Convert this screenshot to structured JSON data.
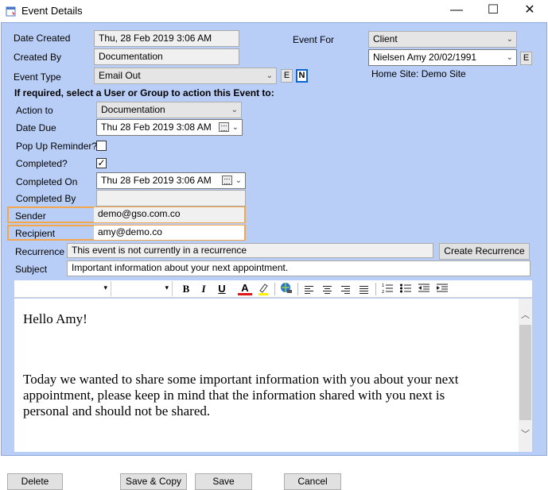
{
  "window": {
    "title": "Event Details",
    "minimize": "—",
    "maximize": "☐",
    "close": "✕"
  },
  "labels": {
    "date_created": "Date Created",
    "created_by": "Created By",
    "event_type": "Event Type",
    "instruction": "If required, select a User or Group to action this Event to:",
    "action_to": "Action to",
    "date_due": "Date Due",
    "pop_up_reminder": "Pop Up Reminder?",
    "completed": "Completed?",
    "completed_on": "Completed On",
    "completed_by": "Completed By",
    "sender": "Sender",
    "recipient": "Recipient",
    "recurrence": "Recurrence",
    "subject": "Subject",
    "event_for": "Event For",
    "home_site": "Home Site: Demo Site"
  },
  "values": {
    "date_created": "Thu,  28 Feb 2019 3:06 AM",
    "created_by": "Documentation",
    "event_type": "Email Out",
    "action_to": "Documentation",
    "date_due": "Thu  28 Feb 2019   3:08 AM",
    "pop_up_reminder": false,
    "completed": true,
    "completed_on": "Thu  28 Feb 2019   3:06 AM",
    "completed_by": "",
    "sender": "demo@gso.com.co",
    "recipient": "amy@demo.co",
    "recurrence": "This event is not currently in a recurrence",
    "subject": "Important information about your next appointment.",
    "event_for": "Client",
    "client_name": "Nielsen Amy 20/02/1991"
  },
  "small_buttons": {
    "event_type_e": "E",
    "event_type_n": "N",
    "client_e": "E"
  },
  "buttons": {
    "create_recurrence": "Create Recurrence",
    "delete": "Delete",
    "save_copy": "Save & Copy",
    "save": "Save",
    "cancel": "Cancel"
  },
  "toolbar": {
    "bold": "B",
    "italic": "I",
    "underline": "U",
    "font_color": "A",
    "icons": [
      "font-family-select",
      "font-size-select",
      "bold-icon",
      "italic-icon",
      "underline-icon",
      "font-color-icon",
      "highlight-icon",
      "hyperlink-icon",
      "align-left-icon",
      "align-center-icon",
      "align-right-icon",
      "justify-icon",
      "numbered-list-icon",
      "bulleted-list-icon",
      "decrease-indent-icon",
      "increase-indent-icon"
    ]
  },
  "editor": {
    "greeting": "Hello Amy!",
    "body_line1": "Today we wanted to share some important information with you about your next",
    "body_line2": "appointment, please keep in mind that the information shared with you next is",
    "body_line3": "personal and should not be shared."
  },
  "colors": {
    "form_background": "#b9cef6",
    "highlight_border": "#f4a64b",
    "font_color_underline": "#e01818",
    "highlight_color": "#ffee00",
    "n_button_border": "#0a64d6"
  }
}
